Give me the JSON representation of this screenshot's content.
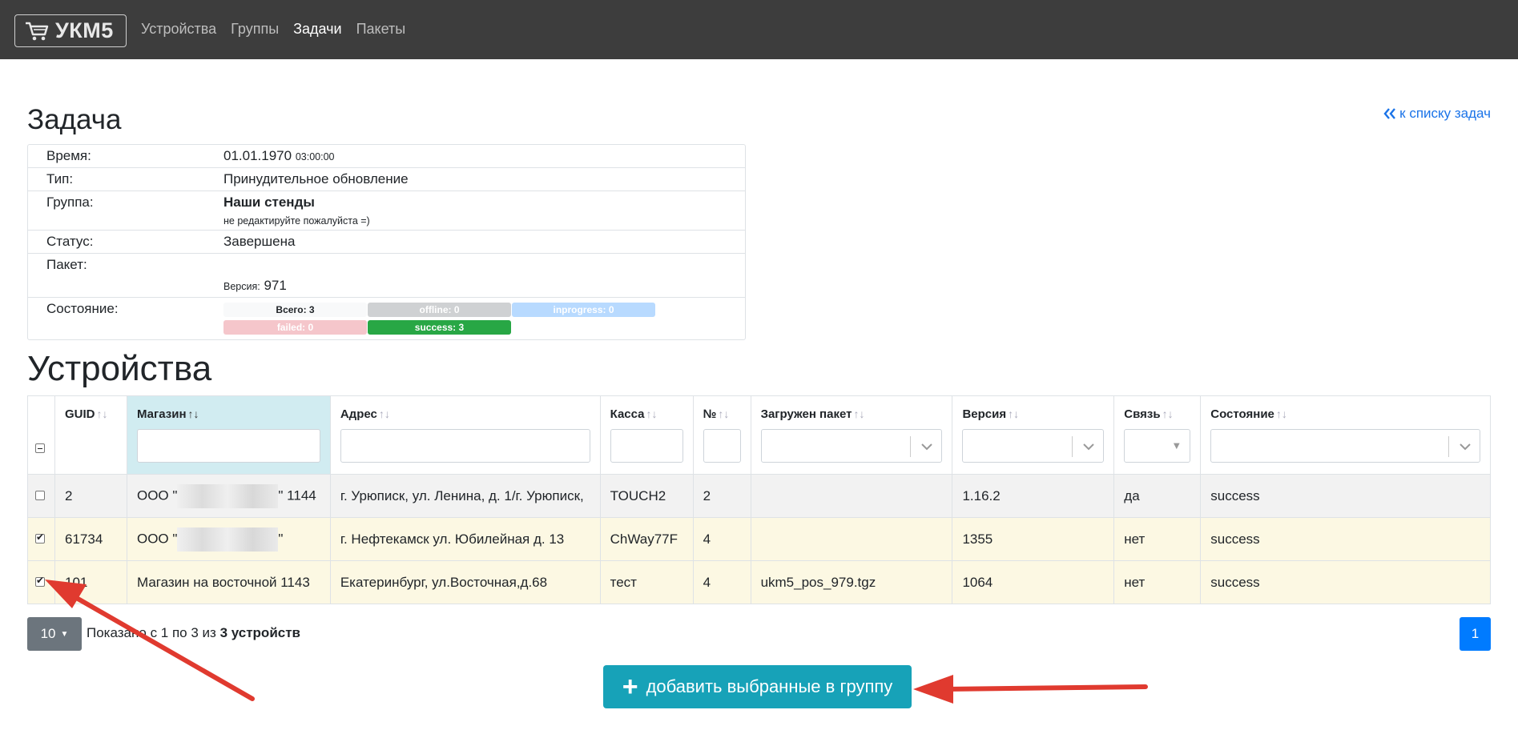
{
  "brand": {
    "name": "УКМ5"
  },
  "nav": {
    "items": [
      {
        "label": "Устройства"
      },
      {
        "label": "Группы"
      },
      {
        "label": "Задачи"
      },
      {
        "label": "Пакеты"
      }
    ]
  },
  "task": {
    "title": "Задача",
    "back_link": "к списку задач",
    "time_label": "Время:",
    "time_date": "01.01.1970",
    "time_clock": "03:00:00",
    "type_label": "Тип:",
    "type_value": "Принудительное обновление",
    "group_label": "Группа:",
    "group_name": "Наши стенды",
    "group_note": "не редактируйте пожалуйста =)",
    "status_label": "Статус:",
    "status_value": "Завершена",
    "package_label": "Пакет:",
    "version_label": "Версия:",
    "version_value": "971",
    "state_label": "Состояние:",
    "state_total": "Всего: 3",
    "state_offline": "offline: 0",
    "state_inprogress": "inprogress: 0",
    "state_failed": "failed: 0",
    "state_success": "success: 3"
  },
  "devices": {
    "title": "Устройства",
    "columns": {
      "guid": "GUID",
      "shop": "Магазин",
      "address": "Адрес",
      "cashbox": "Касса",
      "num": "№",
      "package": "Загружен пакет",
      "version": "Версия",
      "link": "Связь",
      "state": "Состояние"
    },
    "rows": [
      {
        "guid": "2",
        "shop_pre": "ООО \"",
        "shop_post": "\" 1144",
        "address": "г. Урюписк, ул. Ленина, д. 1/г. Урюписк,",
        "cashbox": "TOUCH2",
        "num": "2",
        "package": "",
        "version": "1.16.2",
        "link": "да",
        "state": "success"
      },
      {
        "guid": "61734",
        "shop_pre": "ООО \"",
        "shop_post": "\"",
        "address": "г. Нефтекамск ул. Юбилейная д. 13",
        "cashbox": "ChWay77F",
        "num": "4",
        "package": "",
        "version": "1355",
        "link": "нет",
        "state": "success"
      },
      {
        "guid": "101",
        "shop": "Магазин на восточной 1143",
        "address": "Екатеринбург, ул.Восточная,д.68",
        "cashbox": "тест",
        "num": "4",
        "package": "ukm5_pos_979.tgz",
        "version": "1064",
        "link": "нет",
        "state": "success"
      }
    ]
  },
  "footer": {
    "page_size": "10",
    "showing_prefix": "Показано с 1 по 3 из",
    "showing_bold": "3 устройств",
    "page": "1",
    "add_button": "добавить выбранные в группу"
  },
  "colors": {
    "navbar": "#3d3d3d",
    "primary": "#007bff",
    "info": "#17a2b8",
    "success": "#28a745",
    "annotation_arrow": "#e03a2f"
  }
}
